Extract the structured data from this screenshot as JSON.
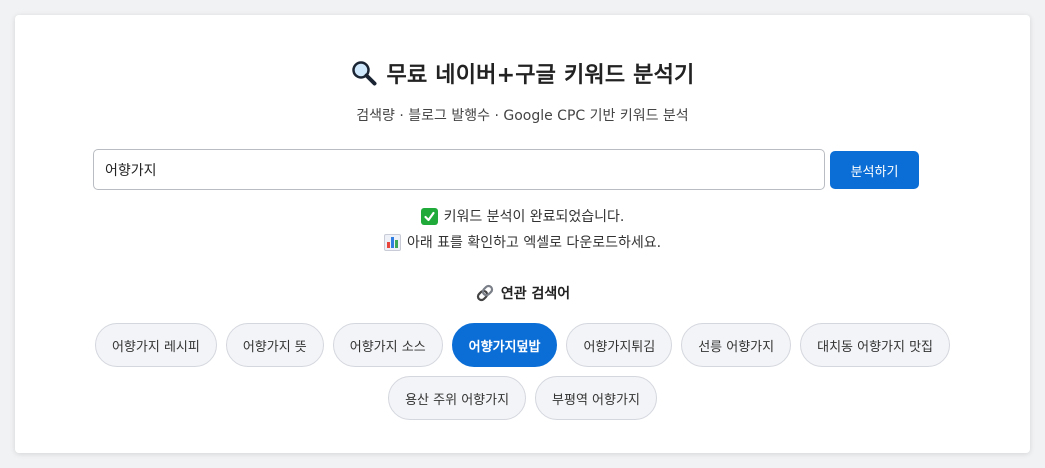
{
  "header": {
    "title": "무료 네이버+구글 키워드 분석기",
    "subtitle": "검색량 · 블로그 발행수 · Google CPC 기반 키워드 분석"
  },
  "search": {
    "value": "어향가지",
    "button_label": "분석하기"
  },
  "status": {
    "line1": "키워드 분석이 완료되었습니다.",
    "line2": "아래 표를 확인하고 엑셀로 다운로드하세요."
  },
  "related": {
    "heading": "연관 검색어",
    "row1": [
      "어향가지 레시피",
      "어향가지 뜻",
      "어향가지 소스",
      "어향가지덮밥",
      "어향가지튀김",
      "선릉 어향가지",
      "대치동 어향가지 맛집"
    ],
    "row2": [
      "용산 주위 어향가지",
      "부평역 어향가지"
    ],
    "active": "어향가지덮밥"
  },
  "colors": {
    "accent": "#0b6ed6",
    "check": "#1faa3a",
    "chip_bg": "#f3f4f7"
  },
  "icons": {
    "title": "magnifier-icon",
    "status1": "check-icon",
    "status2": "bar-chart-icon",
    "related": "link-icon"
  }
}
